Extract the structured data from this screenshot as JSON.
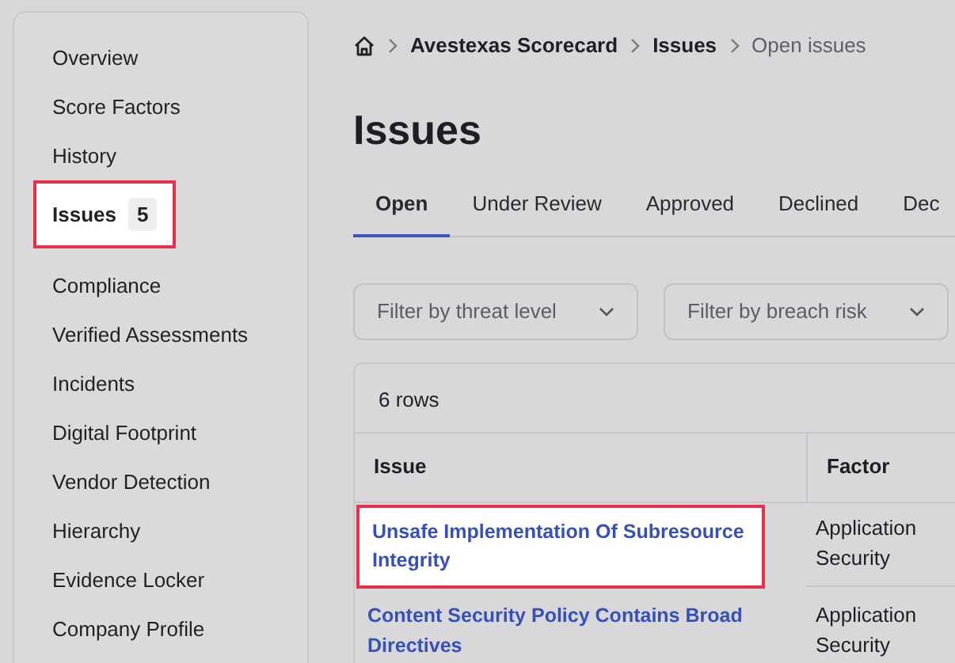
{
  "sidebar": {
    "sections": [
      {
        "items": [
          {
            "label": "Overview",
            "highlighted": false
          },
          {
            "label": "Score Factors",
            "highlighted": false
          },
          {
            "label": "History",
            "highlighted": false
          },
          {
            "label": "Issues",
            "badge": "5",
            "highlighted": true
          }
        ]
      },
      {
        "items": [
          {
            "label": "Compliance",
            "highlighted": false
          },
          {
            "label": "Verified Assessments",
            "highlighted": false
          },
          {
            "label": "Incidents",
            "highlighted": false
          },
          {
            "label": "Digital Footprint",
            "highlighted": false
          },
          {
            "label": "Vendor Detection",
            "highlighted": false
          },
          {
            "label": "Hierarchy",
            "highlighted": false
          },
          {
            "label": "Evidence Locker",
            "highlighted": false
          },
          {
            "label": "Company Profile",
            "highlighted": false
          }
        ]
      }
    ]
  },
  "breadcrumb": [
    {
      "label": "Avestexas Scorecard",
      "current": false
    },
    {
      "label": "Issues",
      "current": false
    },
    {
      "label": "Open issues",
      "current": true
    }
  ],
  "title": "Issues",
  "tabs": [
    {
      "label": "Open",
      "selected": true
    },
    {
      "label": "Under Review",
      "selected": false
    },
    {
      "label": "Approved",
      "selected": false
    },
    {
      "label": "Declined",
      "selected": false
    },
    {
      "label": "Dec",
      "selected": false
    }
  ],
  "filters": [
    {
      "placeholder": "Filter by threat level"
    },
    {
      "placeholder": "Filter by breach risk"
    }
  ],
  "table": {
    "row_count": "6 rows",
    "columns": [
      "Issue",
      "Factor"
    ],
    "rows": [
      {
        "issue": "Unsafe Implementation Of Subresource Integrity",
        "factor": "Application Security",
        "highlighted": true
      },
      {
        "issue": "Content Security Policy Contains Broad Directives",
        "factor": "Application Security",
        "highlighted": false
      }
    ]
  }
}
